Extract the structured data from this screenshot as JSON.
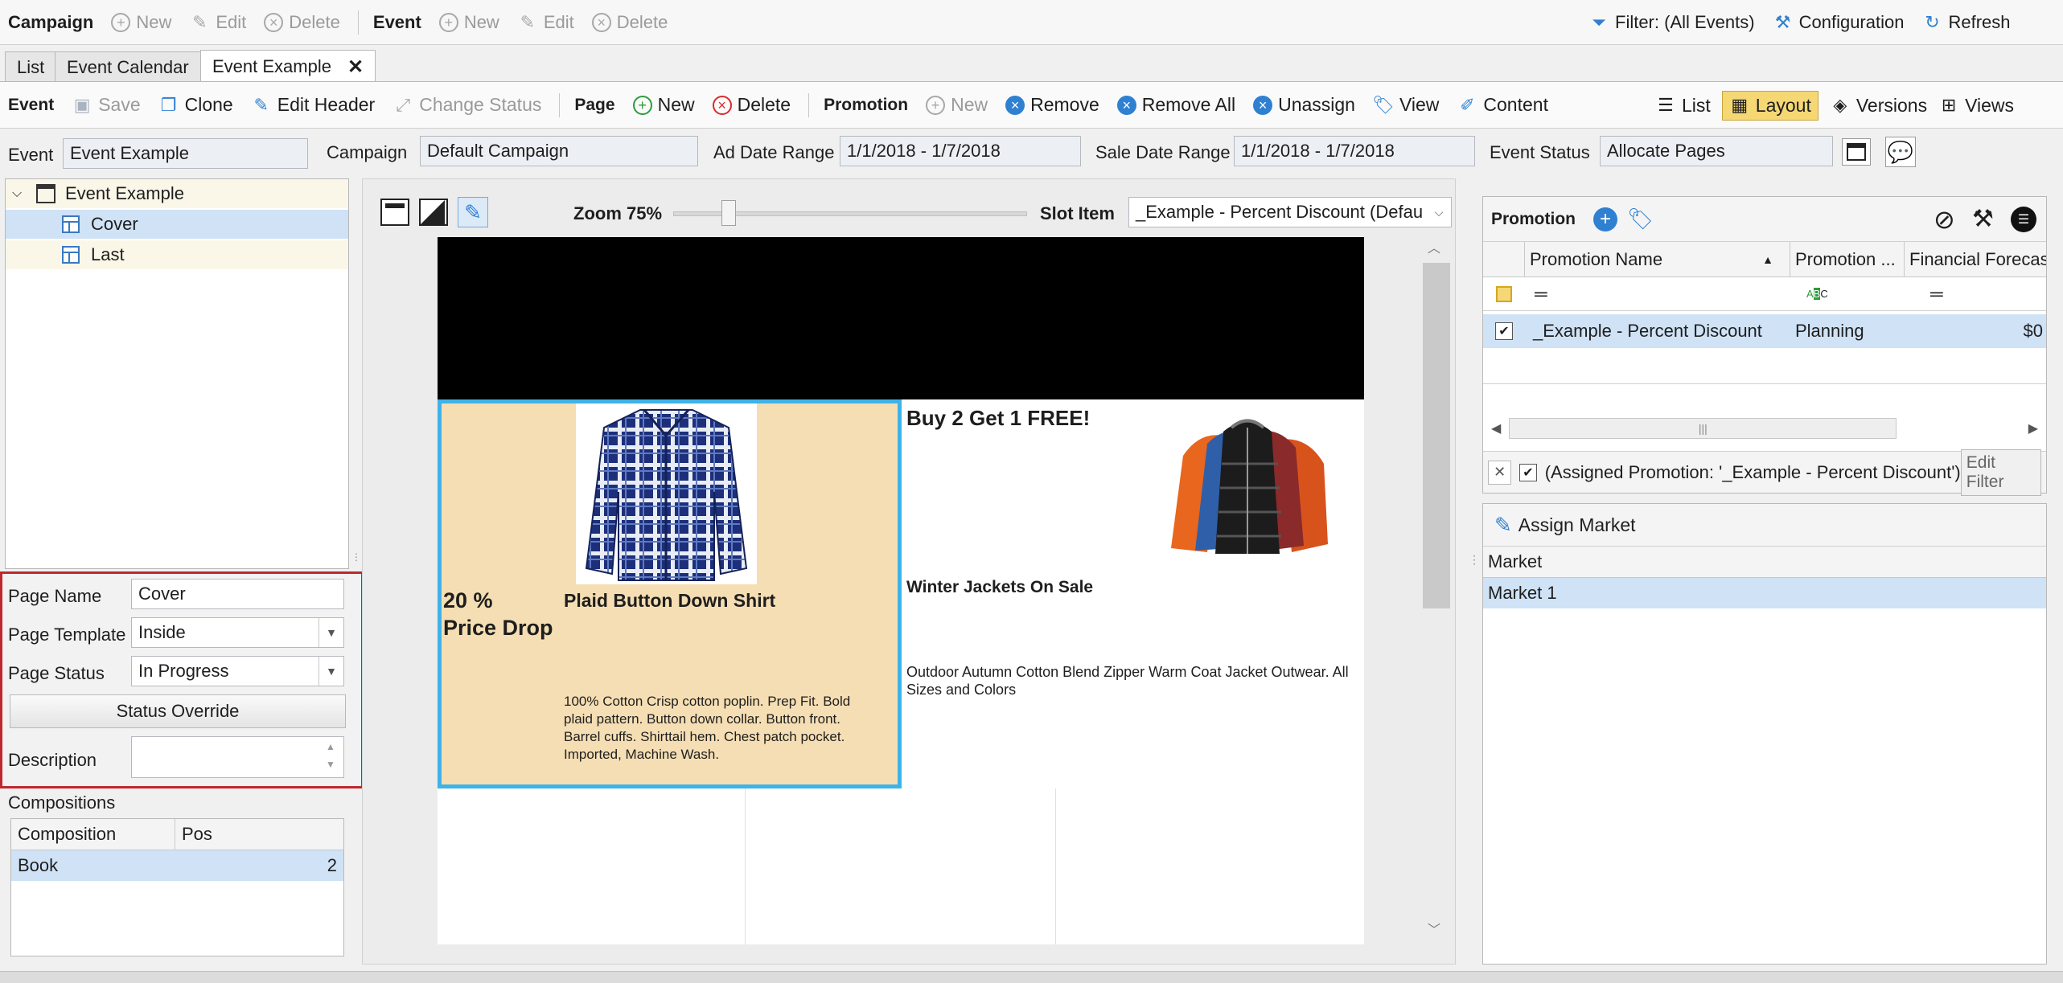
{
  "top_toolbar": {
    "campaign_label": "Campaign",
    "new_label": "New",
    "edit_label": "Edit",
    "delete_label": "Delete",
    "event_label": "Event",
    "event_new_label": "New",
    "event_edit_label": "Edit",
    "event_delete_label": "Delete",
    "filter_label": "Filter: (All Events)",
    "configuration_label": "Configuration",
    "refresh_label": "Refresh"
  },
  "tabs": [
    {
      "label": "List"
    },
    {
      "label": "Event Calendar"
    },
    {
      "label": "Event Example",
      "active": true
    }
  ],
  "second_toolbar": {
    "event_label": "Event",
    "save_label": "Save",
    "clone_label": "Clone",
    "edit_header_label": "Edit Header",
    "change_status_label": "Change Status",
    "page_label": "Page",
    "page_new_label": "New",
    "page_delete_label": "Delete",
    "promotion_label": "Promotion",
    "promo_new_label": "New",
    "remove_label": "Remove",
    "remove_all_label": "Remove All",
    "unassign_label": "Unassign",
    "view_label": "View",
    "content_label": "Content",
    "list_label": "List",
    "layout_label": "Layout",
    "versions_label": "Versions",
    "views_label": "Views"
  },
  "header_fields": {
    "event_label": "Event",
    "event_value": "Event Example",
    "campaign_label": "Campaign",
    "campaign_value": "Default Campaign",
    "ad_date_label": "Ad Date Range",
    "ad_date_value": "1/1/2018 - 1/7/2018",
    "sale_date_label": "Sale Date Range",
    "sale_date_value": "1/1/2018 - 1/7/2018",
    "event_status_label": "Event Status",
    "event_status_value": "Allocate Pages"
  },
  "tree": {
    "root": "Event Example",
    "children": [
      "Cover",
      "Last"
    ]
  },
  "page_props": {
    "page_name_label": "Page Name",
    "page_name_value": "Cover",
    "template_label": "Page Template",
    "template_value": "Inside",
    "status_label": "Page Status",
    "status_value": "In Progress",
    "override_label": "Status Override",
    "description_label": "Description",
    "description_value": ""
  },
  "compositions": {
    "title": "Compositions",
    "columns": [
      "Composition",
      "Pos"
    ],
    "rows": [
      {
        "composition": "Book",
        "pos": "2"
      }
    ]
  },
  "canvas": {
    "zoom_label": "Zoom 75%",
    "zoom_percent": 75,
    "slot_item_label": "Slot Item",
    "slot_item_value": "_Example - Percent Discount (Defau",
    "offer1": {
      "price": "20 %\nPrice Drop",
      "title": "Plaid Button Down Shirt",
      "description": "100% Cotton Crisp cotton poplin. Prep Fit. Bold plaid pattern. Button down collar. Button front. Barrel cuffs. Shirttail hem. Chest patch pocket. Imported, Machine Wash."
    },
    "offer2": {
      "price": "Buy 2 Get 1 FREE!",
      "title": "Winter Jackets On Sale",
      "description": "Outdoor Autumn Cotton Blend Zipper Warm Coat Jacket Outwear. All Sizes and Colors"
    }
  },
  "promotion_panel": {
    "title": "Promotion",
    "columns": [
      "Promotion Name",
      "Promotion ...",
      "Financial Forecas"
    ],
    "rows": [
      {
        "name": "_Example - Percent Discount",
        "status": "Planning",
        "forecast": "$0"
      }
    ],
    "filter_text": "(Assigned Promotion: '_Example - Percent Discount')",
    "edit_filter_label": "Edit Filter"
  },
  "assign_market": {
    "title": "Assign Market",
    "column": "Market",
    "rows": [
      "Market 1"
    ]
  },
  "colors": {
    "accent_blue": "#2f80d1",
    "selection": "#cfe2f6",
    "highlight_border": "#c0282d",
    "offer_bg": "#f5deb3",
    "offer_border": "#3eb3e8",
    "layout_active": "#f5d774"
  }
}
